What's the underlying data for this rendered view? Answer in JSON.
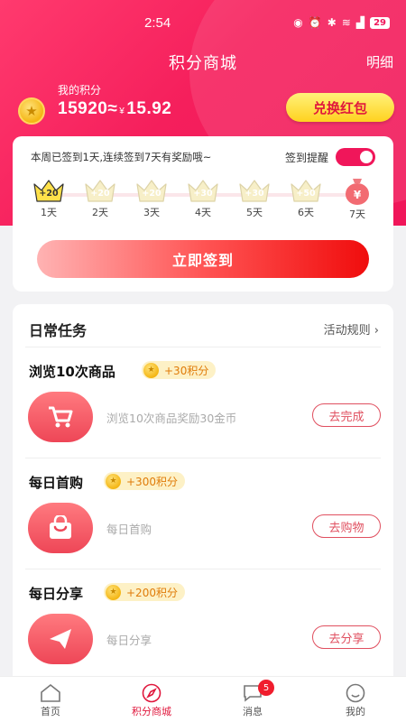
{
  "status_bar": {
    "time": "2:54",
    "battery": "29"
  },
  "header": {
    "title": "积分商城",
    "detail_link": "明细"
  },
  "points": {
    "label": "我的积分",
    "value": "15920≈",
    "currency": "¥",
    "money": "15.92",
    "redeem_button": "兑换红包"
  },
  "signin": {
    "status_text": "本周已签到1天,连续签到7天有奖励哦~",
    "remind_label": "签到提醒",
    "remind_on": true,
    "days": [
      {
        "label": "1天",
        "bonus": "+20",
        "state": "done"
      },
      {
        "label": "2天",
        "bonus": "+20",
        "state": "pending"
      },
      {
        "label": "3天",
        "bonus": "+20",
        "state": "pending"
      },
      {
        "label": "4天",
        "bonus": "+30",
        "state": "pending"
      },
      {
        "label": "5天",
        "bonus": "+30",
        "state": "pending"
      },
      {
        "label": "6天",
        "bonus": "+50",
        "state": "pending"
      },
      {
        "label": "7天",
        "bonus": "¥",
        "state": "gift"
      }
    ],
    "sign_button": "立即签到"
  },
  "tasks": {
    "title": "日常任务",
    "rules_link": "活动规则",
    "items": [
      {
        "name": "浏览10次商品",
        "reward": "+30积分",
        "desc": "浏览10次商品奖励30金币",
        "button": "去完成",
        "icon": "cart-icon"
      },
      {
        "name": "每日首购",
        "reward": "+300积分",
        "desc": "每日首购",
        "button": "去购物",
        "icon": "shopping-bag-icon"
      },
      {
        "name": "每日分享",
        "reward": "+200积分",
        "desc": "每日分享",
        "button": "去分享",
        "icon": "send-icon"
      }
    ]
  },
  "tabbar": {
    "items": [
      {
        "label": "首页",
        "icon": "home-icon"
      },
      {
        "label": "积分商城",
        "icon": "compass-icon",
        "active": true
      },
      {
        "label": "消息",
        "icon": "chat-icon",
        "badge": "5"
      },
      {
        "label": "我的",
        "icon": "profile-icon"
      }
    ]
  },
  "colors": {
    "primary": "#f0165a",
    "accent_yellow": "#ffd21f",
    "button_red": "#f00d0d"
  }
}
